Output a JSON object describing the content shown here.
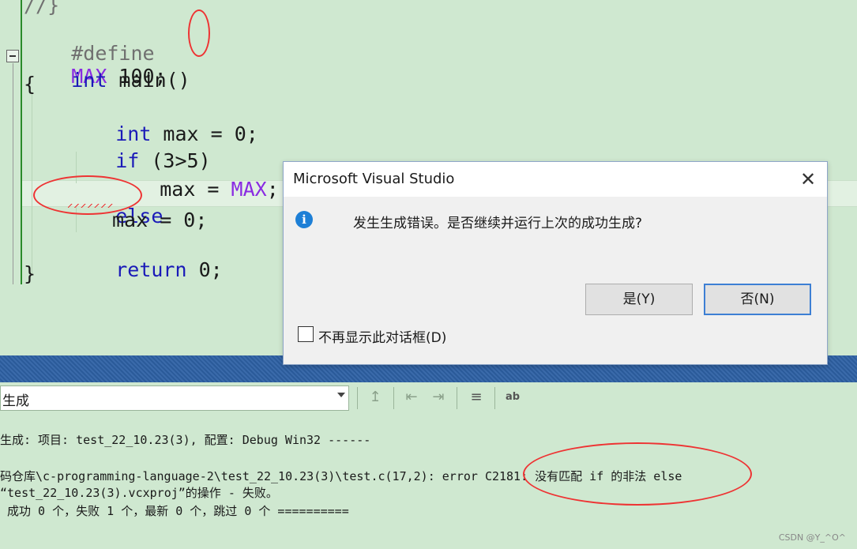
{
  "editor": {
    "lines": {
      "l0": "//}",
      "l1_kw": "#define",
      "l1_macro": "MAX",
      "l1_rest": " 100;",
      "l2_kw": "int",
      "l2_rest": " main()",
      "l3": "{",
      "l4_kw": "int",
      "l4_rest": " max = 0;",
      "l5_kw": "if",
      "l5_rest": " (3>5)",
      "l6_rest": "max = ",
      "l6_macro": "MAX",
      "l6_end": ";",
      "l7_kw": "else",
      "l8": "max = 0;",
      "l9_kw": "return",
      "l9_rest": " 0;",
      "l10": "}"
    }
  },
  "dialog": {
    "title": "Microsoft Visual Studio",
    "close_glyph": "✕",
    "icon_glyph": "i",
    "message": "发生生成错误。是否继续并运行上次的成功生成?",
    "yes_label": "是(Y)",
    "no_label": "否(N)",
    "checkbox_label": "不再显示此对话框(D)",
    "checkbox_checked": false
  },
  "output_panel": {
    "source_selected": "生成",
    "toolbar_icons": {
      "find_in_source": "↥",
      "prev_message": "⇤",
      "next_message": "⇥",
      "clear_all": "≡",
      "word_wrap": "ab"
    },
    "lines": [
      "生成: 项目: test_22_10.23(3), 配置: Debug Win32 ------",
      "",
      "码仓库\\c-programming-language-2\\test_22_10.23(3)\\test.c(17,2): error C2181: 没有匹配 if 的非法 else",
      "“test_22_10.23(3).vcxproj”的操作 - 失败。",
      " 成功 0 个，失败 1 个，最新 0 个，跳过 0 个 =========="
    ]
  },
  "watermark": "CSDN @Y_^O^",
  "colors": {
    "editor_bg": "#cfe8d0",
    "keyword": "#1a1ab8",
    "macro": "#8a2be2",
    "annotation_red": "#e33333",
    "dialog_primary_border": "#3d7fd4",
    "panel_tab_bar": "#2b5b9a"
  }
}
